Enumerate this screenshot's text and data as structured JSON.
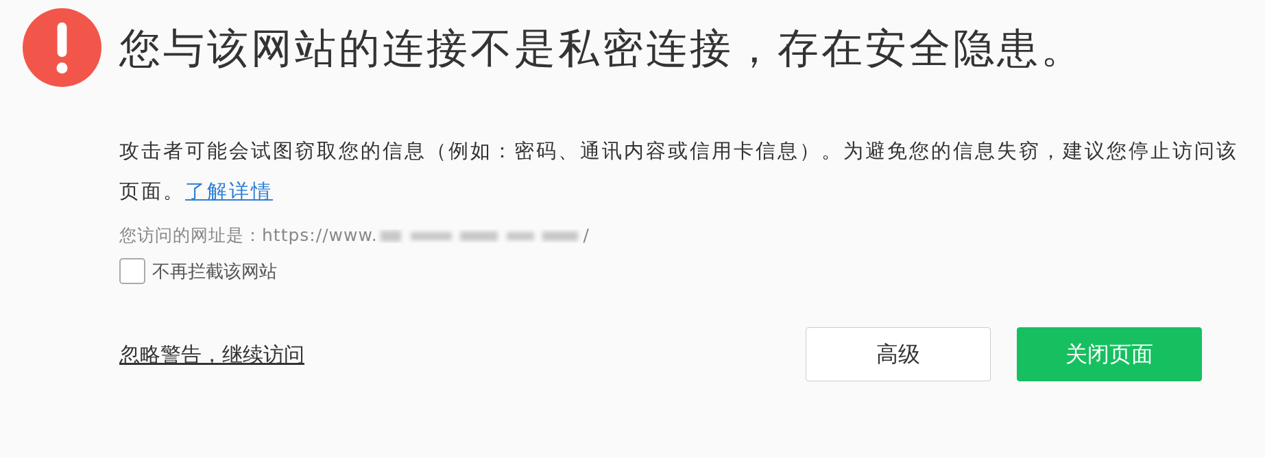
{
  "title": "您与该网站的连接不是私密连接，存在安全隐患。",
  "description": "攻击者可能会试图窃取您的信息（例如：密码、通讯内容或信用卡信息）。为避免您的信息失窃，建议您停止访问该页面。",
  "learn_more_link": "了解详情",
  "url_line": {
    "label": "您访问的网址是：",
    "url_prefix": "https://www.",
    "url_suffix": "/"
  },
  "dont_block_checkbox": {
    "label": "不再拦截该网站",
    "checked": false
  },
  "ignore_link": "忽略警告，继续访问",
  "buttons": [
    {
      "label": "高级",
      "kind": "secondary"
    },
    {
      "label": "关闭页面",
      "kind": "primary"
    }
  ]
}
